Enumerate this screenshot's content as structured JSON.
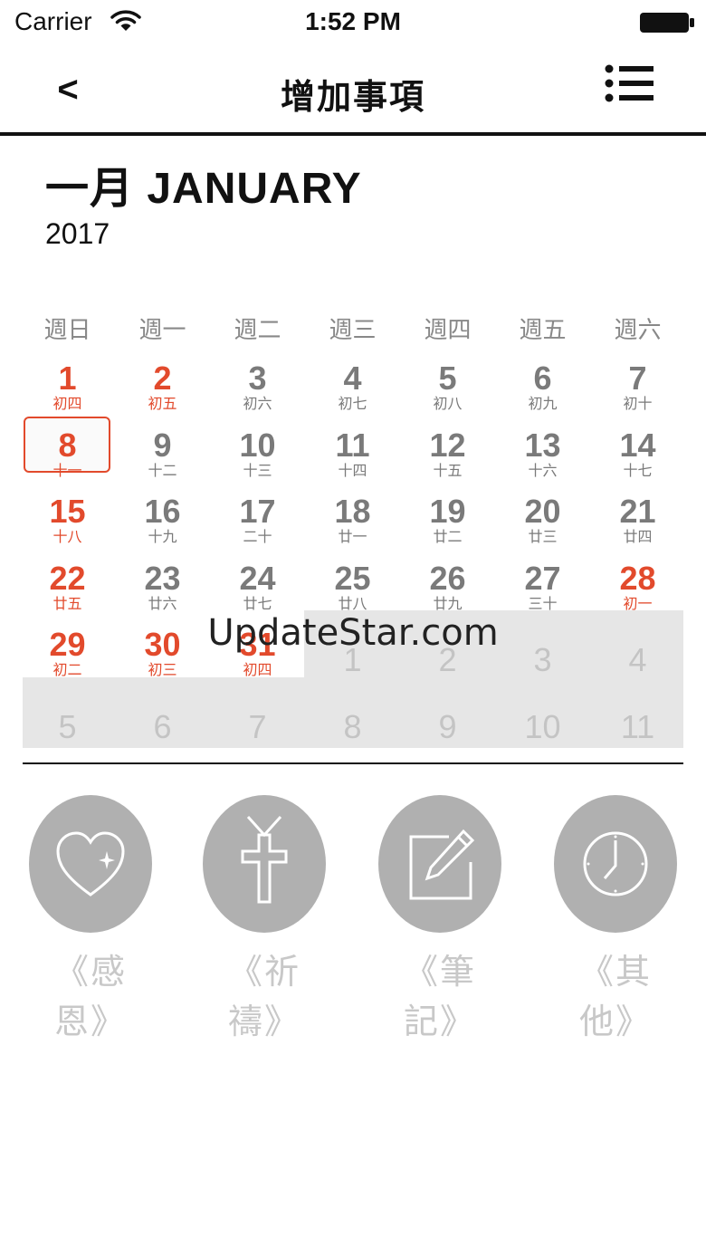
{
  "status_bar": {
    "carrier": "Carrier",
    "time": "1:52 PM"
  },
  "nav": {
    "back_label": "<",
    "title": "增加事項"
  },
  "month": {
    "title": "一月 JANUARY",
    "year": "2017"
  },
  "weekdays": [
    "週日",
    "週一",
    "週二",
    "週三",
    "週四",
    "週五",
    "週六"
  ],
  "calendar": {
    "accent_color": "#e24a2c",
    "selected_day": "8",
    "weeks": [
      [
        {
          "day": "1",
          "lunar": "初四",
          "red": true
        },
        {
          "day": "2",
          "lunar": "初五",
          "red": true
        },
        {
          "day": "3",
          "lunar": "初六"
        },
        {
          "day": "4",
          "lunar": "初七"
        },
        {
          "day": "5",
          "lunar": "初八"
        },
        {
          "day": "6",
          "lunar": "初九"
        },
        {
          "day": "7",
          "lunar": "初十"
        }
      ],
      [
        {
          "day": "8",
          "lunar": "十一",
          "red": true,
          "today": true
        },
        {
          "day": "9",
          "lunar": "十二"
        },
        {
          "day": "10",
          "lunar": "十三"
        },
        {
          "day": "11",
          "lunar": "十四"
        },
        {
          "day": "12",
          "lunar": "十五"
        },
        {
          "day": "13",
          "lunar": "十六"
        },
        {
          "day": "14",
          "lunar": "十七"
        }
      ],
      [
        {
          "day": "15",
          "lunar": "十八",
          "red": true
        },
        {
          "day": "16",
          "lunar": "十九"
        },
        {
          "day": "17",
          "lunar": "二十"
        },
        {
          "day": "18",
          "lunar": "廿一"
        },
        {
          "day": "19",
          "lunar": "廿二"
        },
        {
          "day": "20",
          "lunar": "廿三"
        },
        {
          "day": "21",
          "lunar": "廿四"
        }
      ],
      [
        {
          "day": "22",
          "lunar": "廿五",
          "red": true
        },
        {
          "day": "23",
          "lunar": "廿六"
        },
        {
          "day": "24",
          "lunar": "廿七"
        },
        {
          "day": "25",
          "lunar": "廿八"
        },
        {
          "day": "26",
          "lunar": "廿九"
        },
        {
          "day": "27",
          "lunar": "三十"
        },
        {
          "day": "28",
          "lunar": "初一",
          "red": true
        }
      ],
      [
        {
          "day": "29",
          "lunar": "初二",
          "red": true
        },
        {
          "day": "30",
          "lunar": "初三",
          "red": true
        },
        {
          "day": "31",
          "lunar": "初四",
          "red": true
        },
        {
          "day": "1",
          "other": true
        },
        {
          "day": "2",
          "other": true
        },
        {
          "day": "3",
          "other": true
        },
        {
          "day": "4",
          "other": true
        }
      ],
      [
        {
          "day": "5",
          "other": true
        },
        {
          "day": "6",
          "other": true
        },
        {
          "day": "7",
          "other": true
        },
        {
          "day": "8",
          "other": true
        },
        {
          "day": "9",
          "other": true
        },
        {
          "day": "10",
          "other": true
        },
        {
          "day": "11",
          "other": true
        }
      ]
    ]
  },
  "categories": [
    {
      "label": "《感恩》",
      "icon": "heart-icon"
    },
    {
      "label": "《祈禱》",
      "icon": "cross-icon"
    },
    {
      "label": "《筆記》",
      "icon": "note-edit-icon"
    },
    {
      "label": "《其他》",
      "icon": "clock-icon"
    }
  ],
  "watermark": "UpdateStar.com"
}
